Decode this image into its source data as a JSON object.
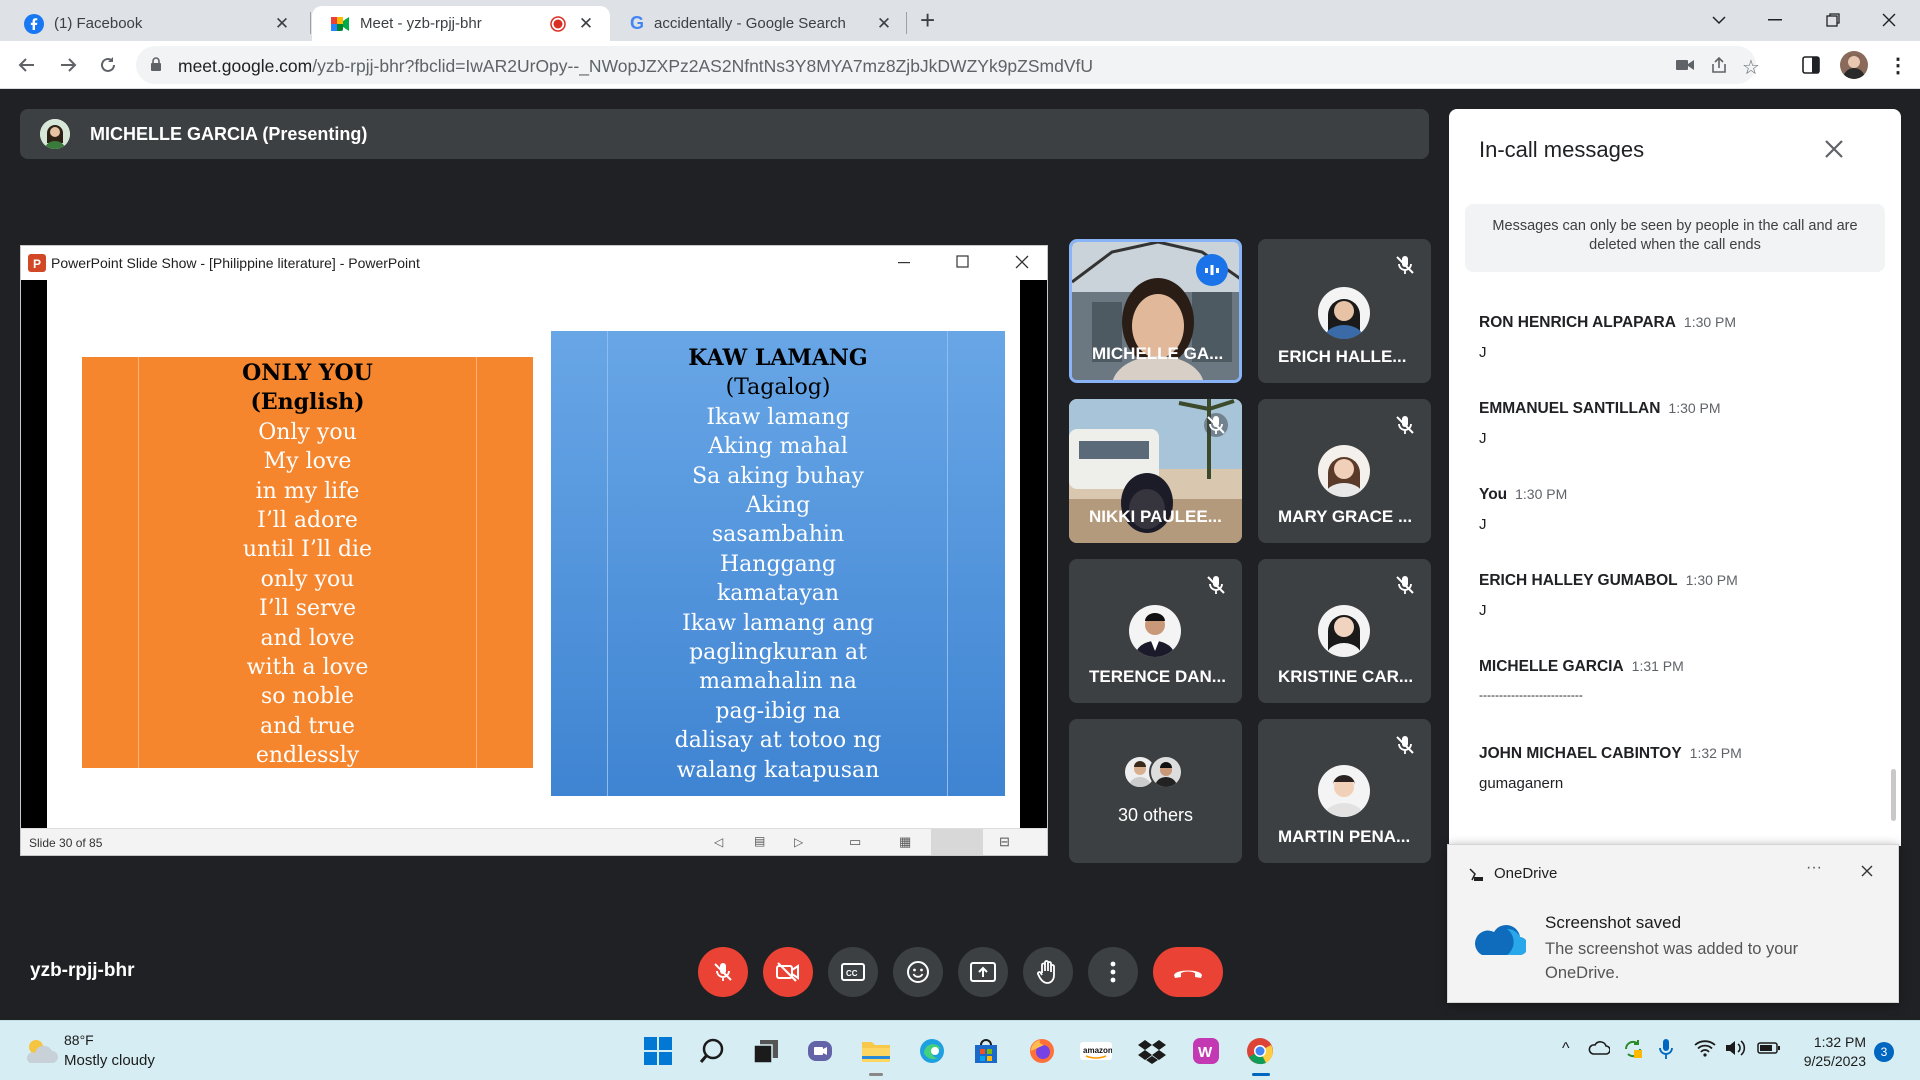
{
  "browser": {
    "tabs": [
      {
        "title": "(1) Facebook",
        "icon": "facebook-icon"
      },
      {
        "title": "Meet - yzb-rpjj-bhr",
        "icon": "google-meet-icon",
        "recording": true
      },
      {
        "title": "accidentally - Google Search",
        "icon": "google-icon"
      }
    ],
    "url_host": "meet.google.com",
    "url_path": "/yzb-rpjj-bhr?fbclid=IwAR2UrOpy--_NWopJZXPz2AS2NfntNs3Y8MYA7mz8ZjbJkDWZYk9pZSmdVfU"
  },
  "meet": {
    "presenter_label": "MICHELLE GARCIA (Presenting)",
    "meeting_code": "yzb-rpjj-bhr",
    "tiles": [
      {
        "name": "MICHELLE GA...",
        "speaking": true
      },
      {
        "name": "ERICH HALLE...",
        "muted": true
      },
      {
        "name": "NIKKI PAULEE...",
        "muted": true
      },
      {
        "name": "MARY GRACE ...",
        "muted": true
      },
      {
        "name": "TERENCE DAN...",
        "muted": true
      },
      {
        "name": "KRISTINE CAR...",
        "muted": true
      },
      {
        "name": "30 others"
      },
      {
        "name": "MARTIN PENA...",
        "muted": true
      }
    ]
  },
  "ppt": {
    "window_title": "PowerPoint Slide Show - [Philippine literature] - PowerPoint",
    "slide_status": "Slide 30 of 85",
    "left_box": {
      "title": "ONLY YOU",
      "subtitle": "(English)",
      "lines": [
        "Only you",
        "My love",
        "in my life",
        "I’ll adore",
        "until I’ll die",
        "only you",
        "I’ll serve",
        "and love",
        "with a love",
        "so noble",
        "and true",
        "endlessly"
      ]
    },
    "right_box": {
      "title": "KAW LAMANG",
      "subtitle": "(Tagalog)",
      "lines": [
        "Ikaw lamang",
        "Aking mahal",
        "Sa aking buhay",
        "Aking",
        "sasambahin",
        "Hanggang",
        "kamatayan",
        "Ikaw lamang ang",
        "paglingkuran at",
        "mamahalin na",
        "pag-ibig na",
        "dalisay at totoo ng",
        "walang katapusan"
      ]
    }
  },
  "panel": {
    "title": "In-call messages",
    "notice": "Messages can only be seen by people in the call and are deleted when the call ends",
    "messages": [
      {
        "sender": "RON HENRICH ALPAPARA",
        "time": "1:30 PM",
        "text": "J"
      },
      {
        "sender": "EMMANUEL SANTILLAN",
        "time": "1:30 PM",
        "text": "J"
      },
      {
        "sender": "You",
        "time": "1:30 PM",
        "text": "J"
      },
      {
        "sender": "ERICH HALLEY GUMABOL",
        "time": "1:30 PM",
        "text": "J"
      },
      {
        "sender": "MICHELLE GARCIA",
        "time": "1:31 PM",
        "text": "--------------------------"
      },
      {
        "sender": "JOHN MICHAEL CABINTOY",
        "time": "1:32 PM",
        "text": "gumaganern"
      }
    ]
  },
  "toast": {
    "app": "OneDrive",
    "heading": "Screenshot saved",
    "body": "The screenshot was added to your OneDrive."
  },
  "taskbar": {
    "temp": "88°F",
    "weather": "Mostly cloudy",
    "time": "1:32 PM",
    "date": "9/25/2023",
    "notifications": "3"
  },
  "colors": {
    "meet_bg": "#202124",
    "end_call": "#ea4335",
    "slide_orange": "#f5862e",
    "slide_blue": "#4a8fd8"
  }
}
